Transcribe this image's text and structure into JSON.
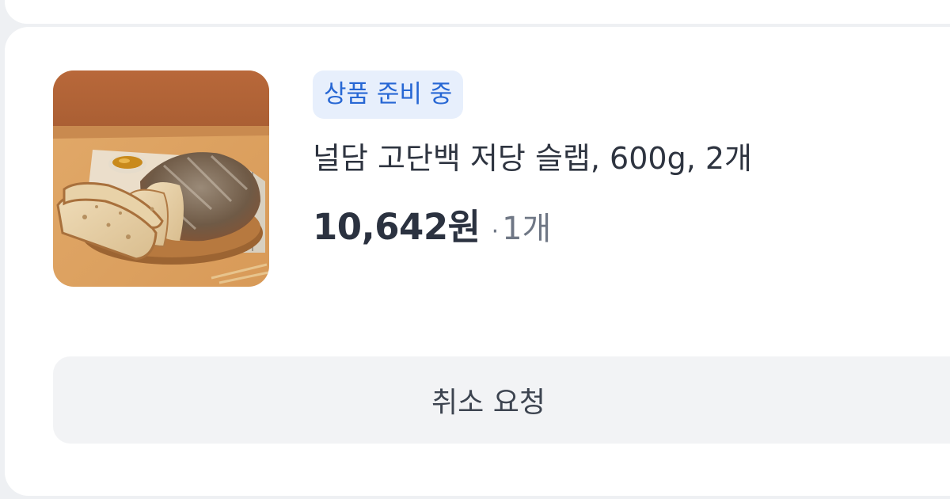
{
  "order_item": {
    "status_badge": "상품 준비 중",
    "product_name": "널담 고단백 저당 슬랩, 600g, 2개",
    "price": "10,642원",
    "separator": "·",
    "quantity": "1개",
    "image": "bread-loaf-product-photo"
  },
  "actions": {
    "cancel_request_label": "취소 요청"
  },
  "colors": {
    "badge_bg": "#e7effc",
    "badge_text": "#2767d4",
    "text_primary": "#2b3240",
    "text_secondary": "#6f7785",
    "button_bg": "#f2f3f5"
  }
}
